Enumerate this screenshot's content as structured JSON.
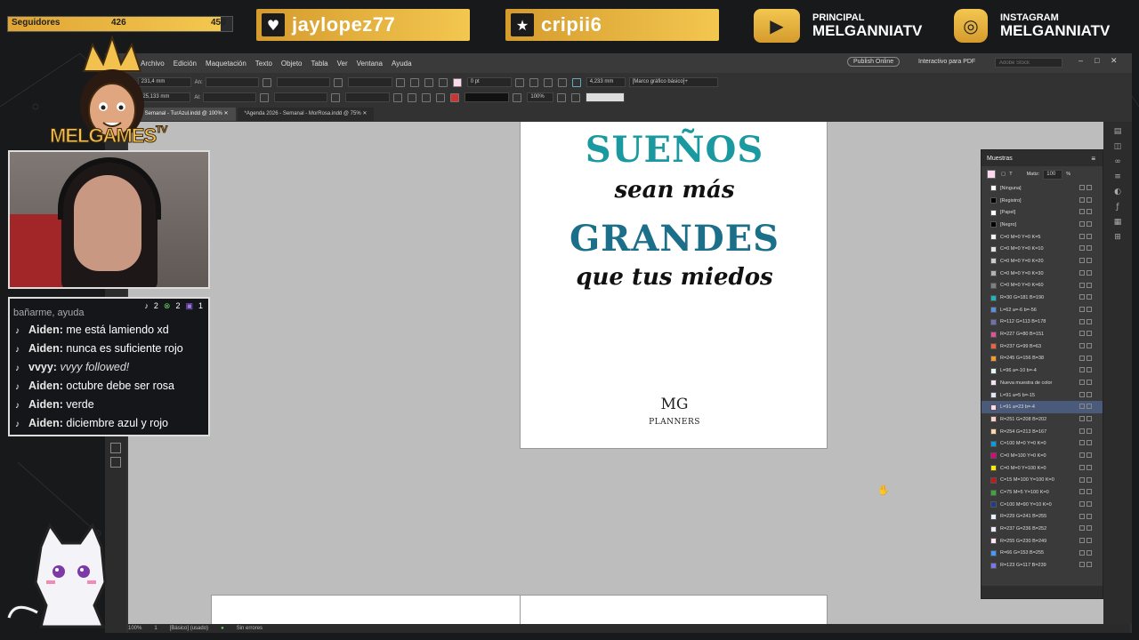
{
  "overlay": {
    "followers": {
      "label": "Seguidores",
      "current": "426",
      "goal": "450",
      "fraction": 0.9467
    },
    "badges": [
      {
        "icon": "heart-icon",
        "name": "jaylopez77"
      },
      {
        "icon": "star-icon",
        "name": "cripii6"
      }
    ],
    "socials": [
      {
        "icon": "youtube-icon",
        "small": "PRINCIPAL",
        "big": "MELGANNIATV"
      },
      {
        "icon": "instagram-icon",
        "small": "INSTAGRAM",
        "big": "MELGANNIATV"
      }
    ],
    "mascot_text": "MELGAMES",
    "mascot_tv": "TV"
  },
  "chat": {
    "header": "bañarme, ayuda",
    "counts": {
      "tiktok": "2",
      "xbox": "2",
      "twitch": "1"
    },
    "messages": [
      {
        "user": "Aiden:",
        "text": "me está lamiendo xd",
        "italic": false
      },
      {
        "user": "Aiden:",
        "text": "nunca es suficiente rojo",
        "italic": false
      },
      {
        "user": "vvyy:",
        "text": "vvyy followed!",
        "italic": true
      },
      {
        "user": "Aiden:",
        "text": "octubre debe ser rosa",
        "italic": false
      },
      {
        "user": "Aiden:",
        "text": "verde",
        "italic": false
      },
      {
        "user": "Aiden:",
        "text": "diciembre azul y rojo",
        "italic": false
      }
    ]
  },
  "app": {
    "menu": [
      "Archivo",
      "Edición",
      "Maquetación",
      "Texto",
      "Objeto",
      "Tabla",
      "Ver",
      "Ventana",
      "Ayuda"
    ],
    "publish": "Publish Online",
    "workspace": "Interactivo para PDF",
    "search_placeholder": "Adobe Stock",
    "x_label": "X:",
    "x_value": "231,4 mm",
    "y_label": "Y:",
    "y_value": "-25,133 mm",
    "an_label": "An:",
    "al_label": "Al:",
    "stroke_value": "0 pt",
    "scale_value": "100%",
    "size_value": "4,233 mm",
    "frame_style": "[Marco gráfico básico]+",
    "tabs": [
      {
        "label": "6 - Semanal - TurAzul.indd @ 100%",
        "active": true
      },
      {
        "label": "*Agenda 2026 - Semanal - MorRosa.indd @ 75%",
        "active": false
      }
    ],
    "status": {
      "zoom": "100%",
      "page": "1",
      "style": "[Básico] (usado)",
      "errors": "Sin errores"
    }
  },
  "page": {
    "line1": "SUEÑOS",
    "line2": "sean más",
    "line3": "GRANDES",
    "line4": "que tus miedos",
    "logo": "MG",
    "brand": "PLANNERS"
  },
  "swatches": {
    "title": "Muestras",
    "tint_label": "Matiz:",
    "tint_value": "100",
    "tint_unit": "%",
    "items": [
      {
        "name": "[Ninguna]",
        "color": "#ffffff"
      },
      {
        "name": "[Registro]",
        "color": "#000000"
      },
      {
        "name": "[Papel]",
        "color": "#ffffff"
      },
      {
        "name": "[Negro]",
        "color": "#000000"
      },
      {
        "name": "C=0 M=0 Y=0 K=5",
        "color": "#f2f2f2"
      },
      {
        "name": "C=0 M=0 Y=0 K=10",
        "color": "#e6e6e6"
      },
      {
        "name": "C=0 M=0 Y=0 K=20",
        "color": "#cccccc"
      },
      {
        "name": "C=0 M=0 Y=0 K=30",
        "color": "#b3b3b3"
      },
      {
        "name": "C=0 M=0 Y=0 K=60",
        "color": "#808080"
      },
      {
        "name": "R=30 G=181 B=190",
        "color": "#1eb5be"
      },
      {
        "name": "L=62 a=-6 b=-56",
        "color": "#5a8fe0"
      },
      {
        "name": "R=112 G=113 B=178",
        "color": "#7071b2"
      },
      {
        "name": "R=227 G=80 B=151",
        "color": "#e35097"
      },
      {
        "name": "R=237 G=99 B=63",
        "color": "#ed633f"
      },
      {
        "name": "R=245 G=156 B=38",
        "color": "#f59c26"
      },
      {
        "name": "L=96 a=-10 b=-4",
        "color": "#e8f4f6"
      },
      {
        "name": "Nueva muestra de color",
        "color": "#f4e2ee"
      },
      {
        "name": "L=91 a=5 b=-15",
        "color": "#e4e4fa"
      },
      {
        "name": "L=91 a=23 b=-4",
        "color": "#fcd9ec"
      },
      {
        "name": "R=251 G=208 B=202",
        "color": "#fbd0ca"
      },
      {
        "name": "R=254 G=213 B=167",
        "color": "#fed5a7"
      },
      {
        "name": "C=100 M=0 Y=0 K=0",
        "color": "#00a0e3"
      },
      {
        "name": "C=0 M=100 Y=0 K=0",
        "color": "#e5007e"
      },
      {
        "name": "C=0 M=0 Y=100 K=0",
        "color": "#ffed00"
      },
      {
        "name": "C=15 M=100 Y=100 K=0",
        "color": "#c8161e"
      },
      {
        "name": "C=75 M=5 Y=100 K=0",
        "color": "#3aa935"
      },
      {
        "name": "C=100 M=90 Y=10 K=0",
        "color": "#1d3c8c"
      },
      {
        "name": "R=229 G=241 B=255",
        "color": "#e5f1ff"
      },
      {
        "name": "R=237 G=236 B=252",
        "color": "#edecfc"
      },
      {
        "name": "R=255 G=230 B=249",
        "color": "#ffe6f9"
      },
      {
        "name": "R=66 G=153 B=255",
        "color": "#4299ff"
      },
      {
        "name": "R=123 G=117 B=239",
        "color": "#7b75ef"
      }
    ],
    "selected_index": 18
  }
}
